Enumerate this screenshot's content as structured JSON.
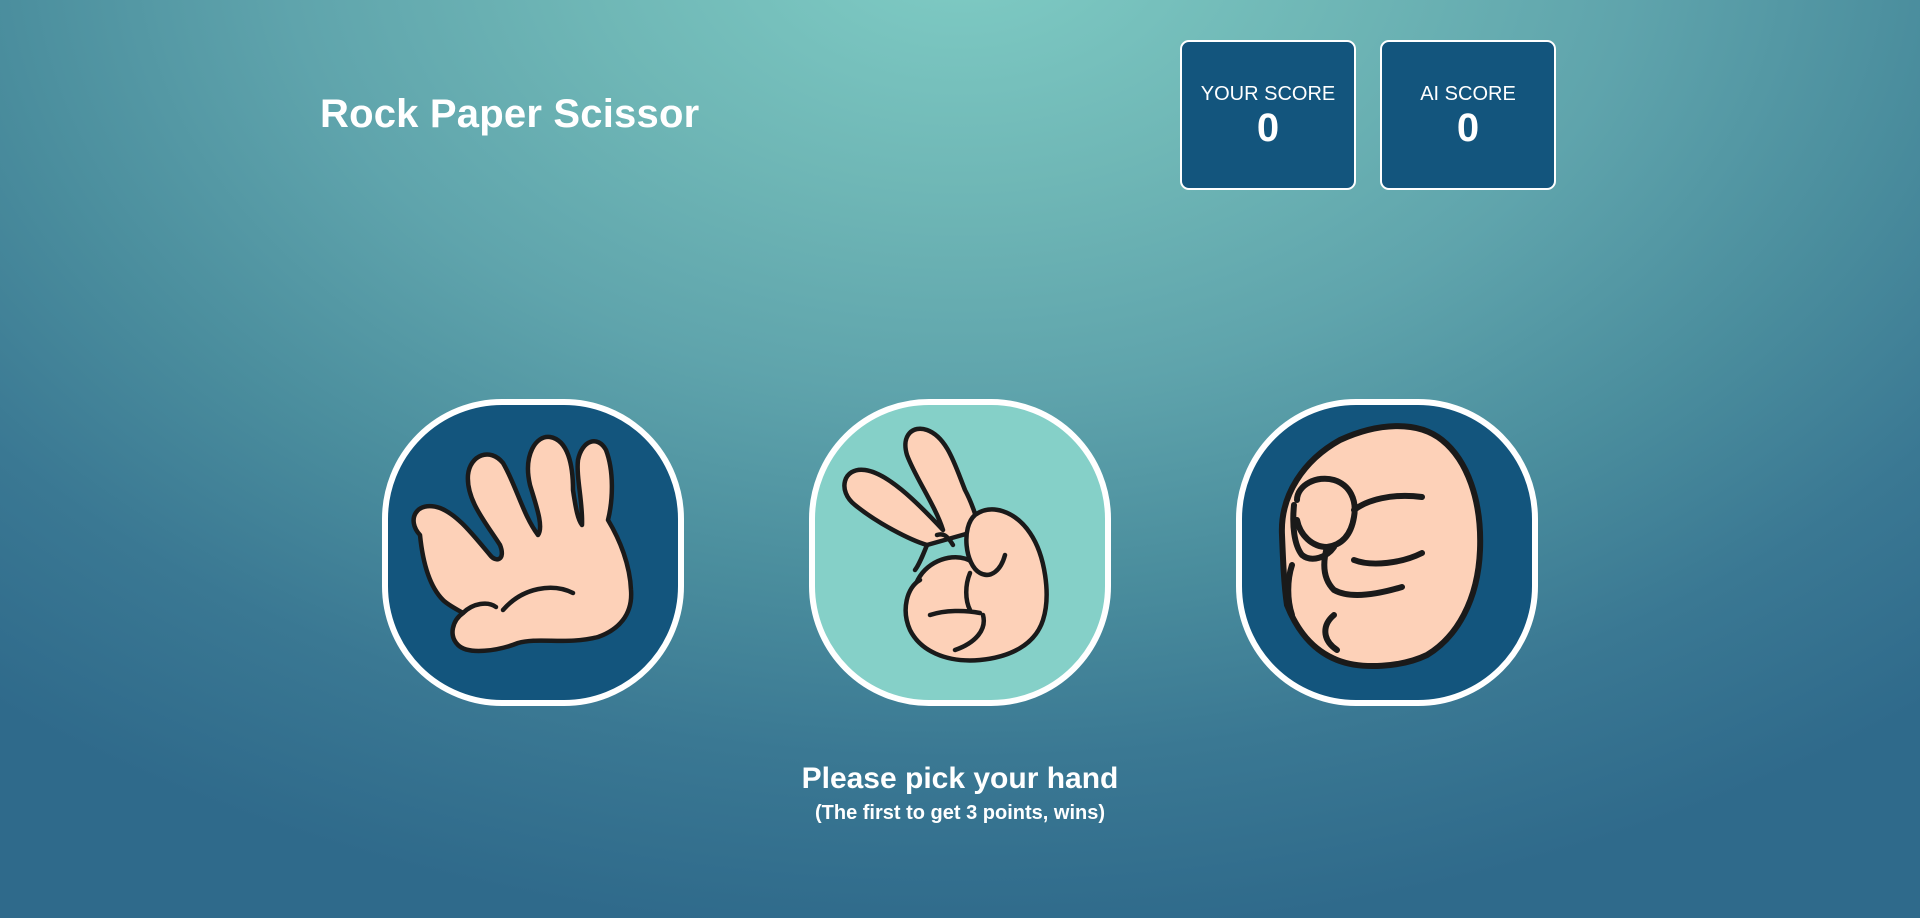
{
  "game": {
    "title": "Rock Paper Scissor"
  },
  "scores": {
    "player": {
      "label": "YOUR SCORE",
      "value": "0"
    },
    "ai": {
      "label": "AI SCORE",
      "value": "0"
    }
  },
  "choices": [
    {
      "name": "paper",
      "icon": "paper-hand-icon",
      "background": "#13557d"
    },
    {
      "name": "scissor",
      "icon": "scissor-hand-icon",
      "background": "#85d0c8"
    },
    {
      "name": "rock",
      "icon": "rock-hand-icon",
      "background": "#13557d"
    }
  ],
  "status": {
    "prompt": "Please pick your hand",
    "rule": "(The first to get 3 points, wins)"
  },
  "colors": {
    "panel": "#13557d",
    "selected_panel": "#85d0c8",
    "skin": "#fdd1b8",
    "outline": "#1a1a1a"
  }
}
